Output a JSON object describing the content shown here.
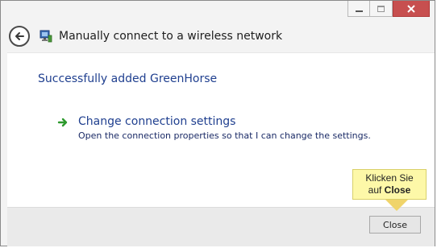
{
  "window": {
    "title": "Manually connect to a wireless network",
    "caption_buttons": [
      "minimize",
      "maximize",
      "close"
    ]
  },
  "main": {
    "status_text": "Successfully added GreenHorse",
    "option": {
      "title": "Change connection settings",
      "description": "Open the connection properties so that I can change the settings."
    }
  },
  "footer": {
    "close_label": "Close"
  },
  "callout": {
    "line1": "Klicken Sie",
    "line2_prefix": "auf ",
    "line2_bold": "Close"
  },
  "icons": {
    "back": "back-arrow-icon",
    "network": "wireless-network-icon",
    "option_arrow": "green-arrow-icon"
  },
  "colors": {
    "link_blue": "#1f3f8f",
    "close_red": "#c74f4f",
    "callout_yellow": "#fdf8a8"
  }
}
